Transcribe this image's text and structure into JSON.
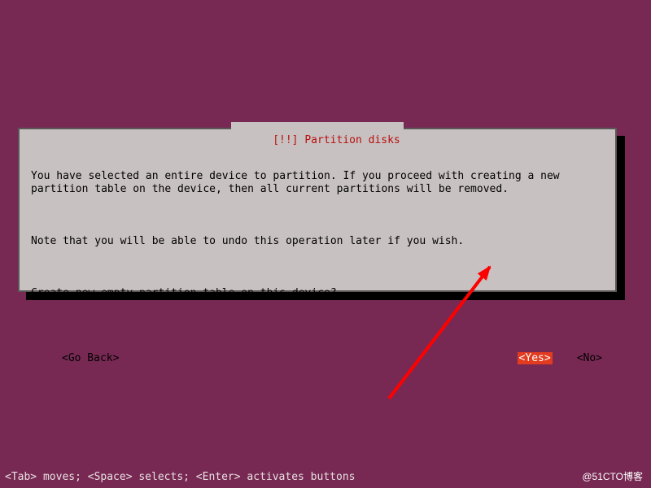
{
  "dialog": {
    "title_prefix": "[!!] ",
    "title_text": "Partition disks",
    "para1": "You have selected an entire device to partition. If you proceed with creating a new partition table on the device, then all current partitions will be removed.",
    "para2": "Note that you will be able to undo this operation later if you wish.",
    "question": "Create new empty partition table on this device?",
    "go_back": "<Go Back>",
    "yes": "<Yes>",
    "no": "<No>"
  },
  "footer": "<Tab> moves; <Space> selects; <Enter> activates buttons",
  "watermark": "@51CTO博客"
}
